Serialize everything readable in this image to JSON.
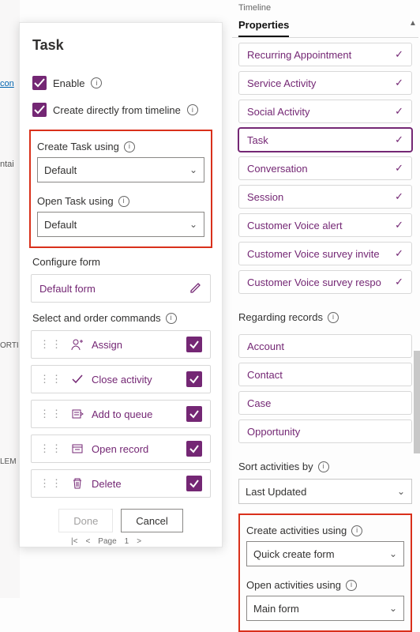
{
  "left_stubs": {
    "link": "con",
    "t2": "ntai",
    "t3": "ORTI",
    "t4": "LEM"
  },
  "panel": {
    "title": "Task",
    "enable": {
      "label": "Enable",
      "checked": true
    },
    "create_direct": {
      "label": "Create directly from timeline",
      "checked": true
    },
    "create_using": {
      "label": "Create Task using",
      "value": "Default"
    },
    "open_using": {
      "label": "Open Task using",
      "value": "Default"
    },
    "configure_form_label": "Configure form",
    "configure_form_value": "Default form",
    "commands_label": "Select and order commands",
    "commands": [
      {
        "icon": "assign",
        "label": "Assign"
      },
      {
        "icon": "close-activity",
        "label": "Close activity"
      },
      {
        "icon": "queue",
        "label": "Add to queue"
      },
      {
        "icon": "open-record",
        "label": "Open record"
      },
      {
        "icon": "delete",
        "label": "Delete"
      }
    ],
    "buttons": {
      "done": "Done",
      "cancel": "Cancel"
    },
    "pager": {
      "page_label": "Page",
      "page": "1"
    }
  },
  "right": {
    "header": "Timeline",
    "tabs": {
      "active": "Properties"
    },
    "activity_types": [
      {
        "label": "Recurring Appointment"
      },
      {
        "label": "Service Activity"
      },
      {
        "label": "Social Activity"
      },
      {
        "label": "Task",
        "selected": true
      },
      {
        "label": "Conversation"
      },
      {
        "label": "Session"
      },
      {
        "label": "Customer Voice alert"
      },
      {
        "label": "Customer Voice survey invite"
      },
      {
        "label": "Customer Voice survey respo"
      }
    ],
    "regarding_label": "Regarding records",
    "regarding": [
      {
        "label": "Account"
      },
      {
        "label": "Contact"
      },
      {
        "label": "Case"
      },
      {
        "label": "Opportunity"
      }
    ],
    "sort_label": "Sort activities by",
    "sort_value": "Last Updated",
    "create_activities": {
      "label": "Create activities using",
      "value": "Quick create form"
    },
    "open_activities": {
      "label": "Open activities using",
      "value": "Main form"
    }
  }
}
